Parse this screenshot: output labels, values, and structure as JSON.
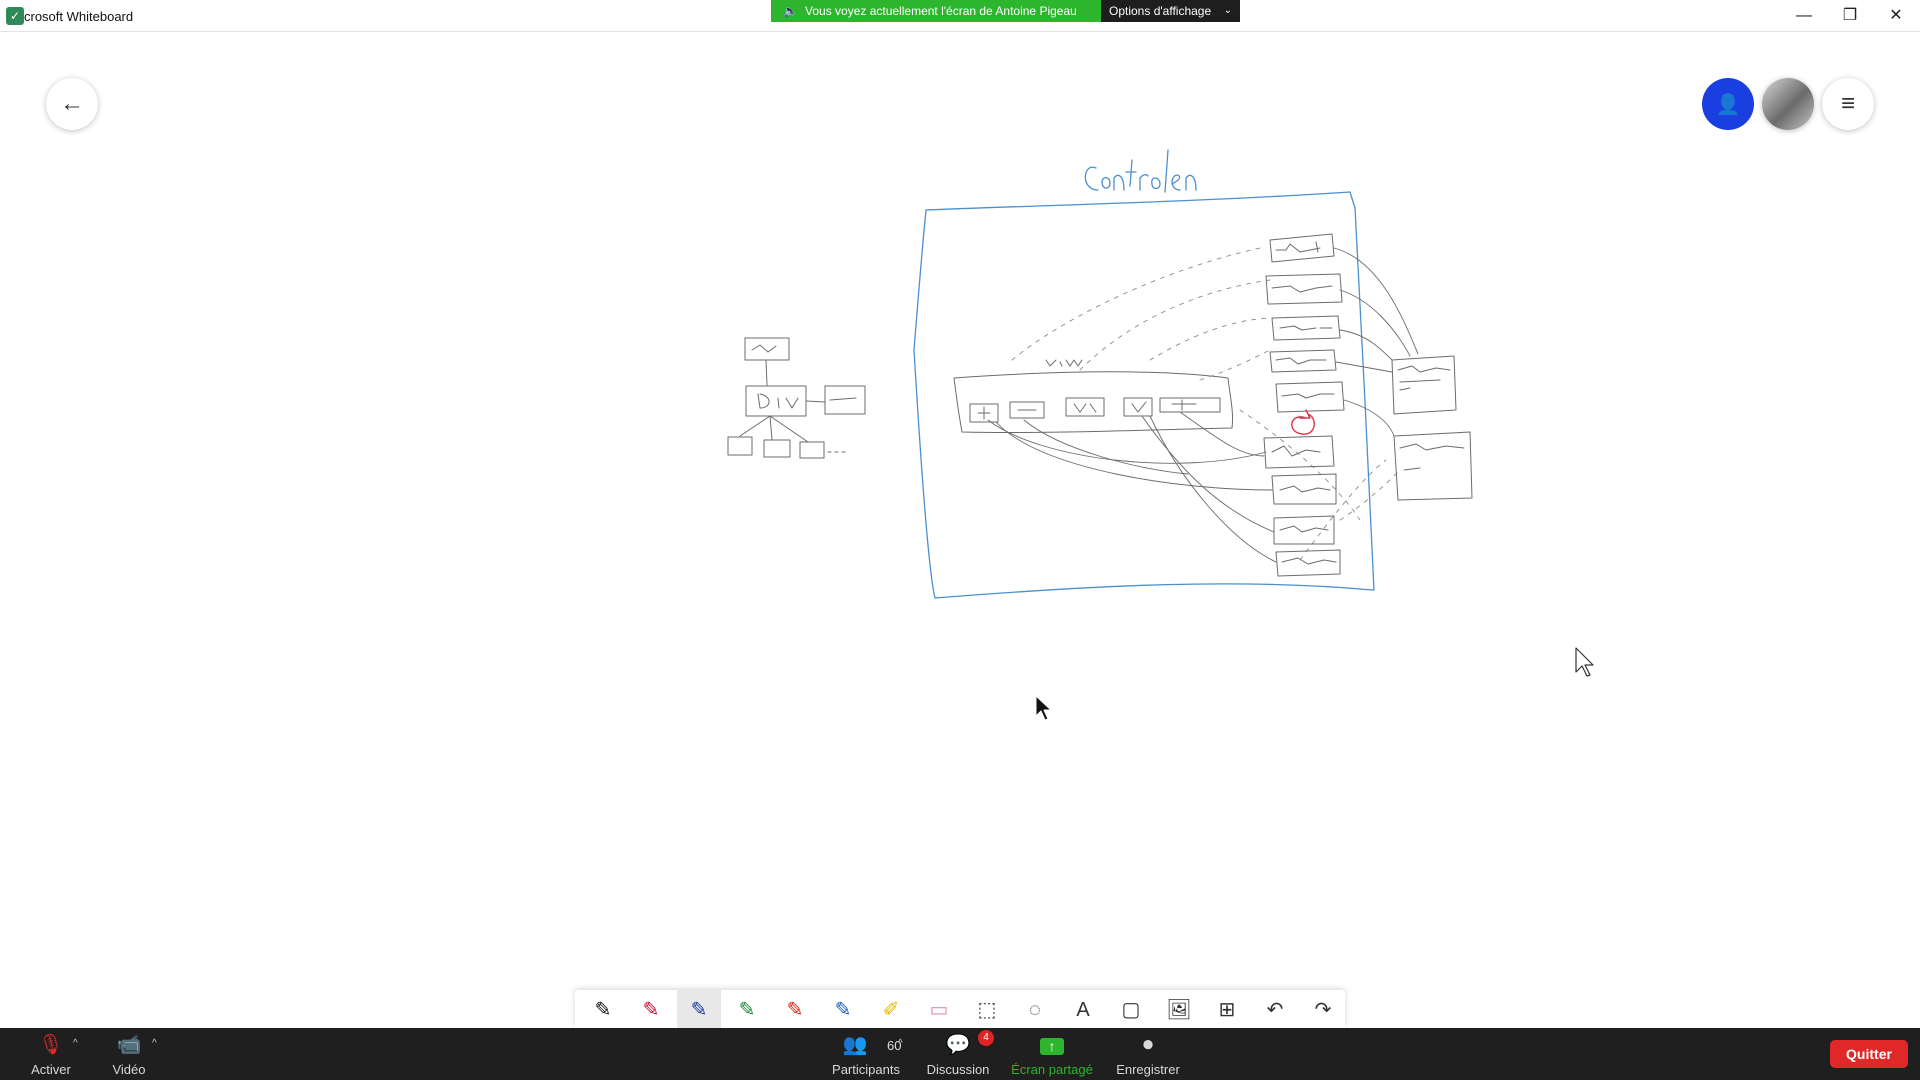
{
  "window": {
    "title": "crosoft Whiteboard",
    "controls": {
      "minimize": "—",
      "restore": "❐",
      "close": "✕"
    }
  },
  "share_banner": {
    "text": "Vous voyez actuellement l'écran de Antoine Pigeau",
    "options_label": "Options d'affichage",
    "options_chevron": "⌄",
    "speaker_icon": "🔈"
  },
  "board": {
    "back_icon": "←",
    "invite_icon": "👤",
    "menu_icon": "≡",
    "colors": {
      "sketch_blue": "#4a8fd0",
      "sketch_gray": "#6b6b6b",
      "sketch_red": "#e0334a"
    }
  },
  "drawing_toolbar": {
    "tools": [
      {
        "name": "black-pen-icon",
        "glyph": "✎"
      },
      {
        "name": "red-pen-icon",
        "glyph": "✎"
      },
      {
        "name": "blue-pen-icon",
        "glyph": "✎",
        "selected": true
      },
      {
        "name": "green-pen-icon",
        "glyph": "✎"
      },
      {
        "name": "red-pen-2-icon",
        "glyph": "✎"
      },
      {
        "name": "blue-pen-2-icon",
        "glyph": "✎"
      },
      {
        "name": "highlighter-icon",
        "glyph": "✐"
      },
      {
        "name": "eraser-icon",
        "glyph": "▭"
      },
      {
        "name": "ruler-icon",
        "glyph": "⬚"
      },
      {
        "name": "lasso-icon",
        "glyph": "◌"
      },
      {
        "name": "text-icon",
        "glyph": "A"
      },
      {
        "name": "note-icon",
        "glyph": "▢"
      },
      {
        "name": "image-icon",
        "glyph": "🖼"
      },
      {
        "name": "insert-icon",
        "glyph": "⊞"
      },
      {
        "name": "undo-icon",
        "glyph": "↶"
      },
      {
        "name": "redo-icon",
        "glyph": "↷"
      }
    ]
  },
  "meeting_bar": {
    "mic": {
      "label": "Activer",
      "icon": "🎙"
    },
    "video": {
      "label": "Vidéo",
      "icon": "📹"
    },
    "participants": {
      "label": "Participants",
      "count": "60",
      "icon": "👥"
    },
    "chat": {
      "label": "Discussion",
      "badge": "4",
      "icon": "💬"
    },
    "share": {
      "label": "Écran partagé",
      "icon": "↑"
    },
    "record": {
      "label": "Enregistrer",
      "icon": "⏺"
    },
    "caret": "^",
    "quit_label": "Quitter"
  }
}
